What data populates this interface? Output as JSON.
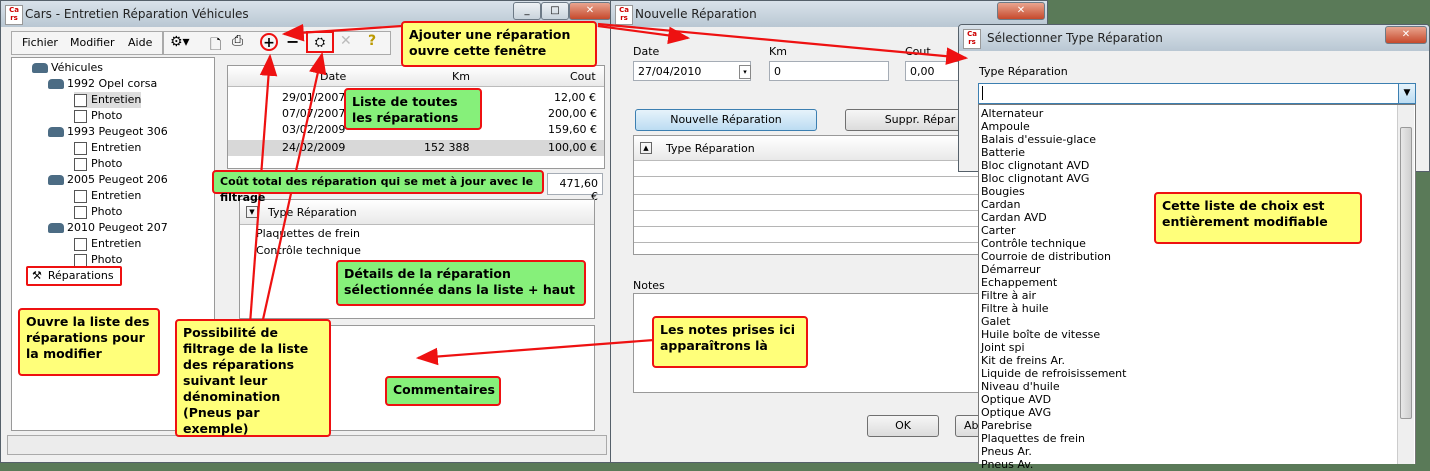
{
  "main_window": {
    "title": "Cars - Entretien Réparation Véhicules",
    "menu": [
      "Fichier",
      "Modifier",
      "Aide"
    ],
    "tree": {
      "root": "Véhicules",
      "vehicles": [
        {
          "name": "1992 Opel corsa",
          "children": [
            "Entretien",
            "Photo"
          ]
        },
        {
          "name": "1993 Peugeot 306",
          "children": [
            "Entretien",
            "Photo"
          ]
        },
        {
          "name": "2005 Peugeot 206",
          "children": [
            "Entretien",
            "Photo"
          ]
        },
        {
          "name": "2010 Peugeot 207",
          "children": [
            "Entretien",
            "Photo"
          ]
        }
      ],
      "repairs": "Réparations"
    },
    "table": {
      "headers": [
        "Date",
        "Km",
        "Cout"
      ],
      "rows": [
        [
          "29/01/2007",
          "",
          "12,00 €"
        ],
        [
          "07/07/2007",
          "",
          "200,00 €"
        ],
        [
          "03/02/2009",
          "",
          "159,60 €"
        ],
        [
          "24/02/2009",
          "152 388",
          "100,00 €"
        ]
      ]
    },
    "total": "471,60 €",
    "detail": {
      "header": "Type Réparation",
      "items": [
        "Plaquettes de frein",
        "Contrôle technique"
      ]
    }
  },
  "dialog_repair": {
    "title": "Nouvelle Réparation",
    "date_label": "Date",
    "date_value": "27/04/2010",
    "km_label": "Km",
    "km_value": "0",
    "cout_label": "Cout",
    "cout_value": "0,00",
    "new_button": "Nouvelle Réparation",
    "delete_button": "Suppr. Répar",
    "grid_header": "Type Réparation",
    "notes_label": "Notes",
    "ok_button": "OK",
    "cancel_button": "Ab"
  },
  "dialog_type": {
    "title": "Sélectionner Type Réparation",
    "label": "Type Réparation",
    "input_value": "",
    "options": [
      "Alternateur",
      "Ampoule",
      "Balais d'essuie-glace",
      "Batterie",
      "Bloc clignotant AVD",
      "Bloc clignotant AVG",
      "Bougies",
      "Cardan",
      "Cardan AVD",
      "Carter",
      "Contrôle technique",
      "Courroie de distribution",
      "Démarreur",
      "Echappement",
      "Filtre à air",
      "Filtre à huile",
      "Galet",
      "Huile boîte de vitesse",
      "Joint spi",
      "Kit de freins Ar.",
      "Liquide de refroisissement",
      "Niveau d'huile",
      "Optique AVD",
      "Optique AVG",
      "Parebrise",
      "Plaquettes de frein",
      "Pneus Ar.",
      "Pneus Av."
    ]
  },
  "annotations": {
    "add_repair": "Ajouter une réparation ouvre cette fenêtre",
    "all_repairs": "Liste de toutes les réparations",
    "total_cost": "Coût total des réparation qui se met à jour avec le filtrage",
    "details": "Détails de la réparation sélectionnée dans la liste + haut",
    "open_list": "Ouvre la liste des réparations pour la modifier",
    "filter": "Possibilité de filtrage de la liste des réparations suivant leur dénomination (Pneus par exemple)",
    "notes": "Les notes prises ici apparaîtrons là",
    "comments": "Commentaires",
    "choice_list": "Cette liste de choix est entièrement modifiable"
  },
  "colors": {
    "note_yellow": "#ffff7a",
    "note_green": "#86f07a",
    "note_border": "#ee1111",
    "selected_button": "#cde6f7"
  }
}
